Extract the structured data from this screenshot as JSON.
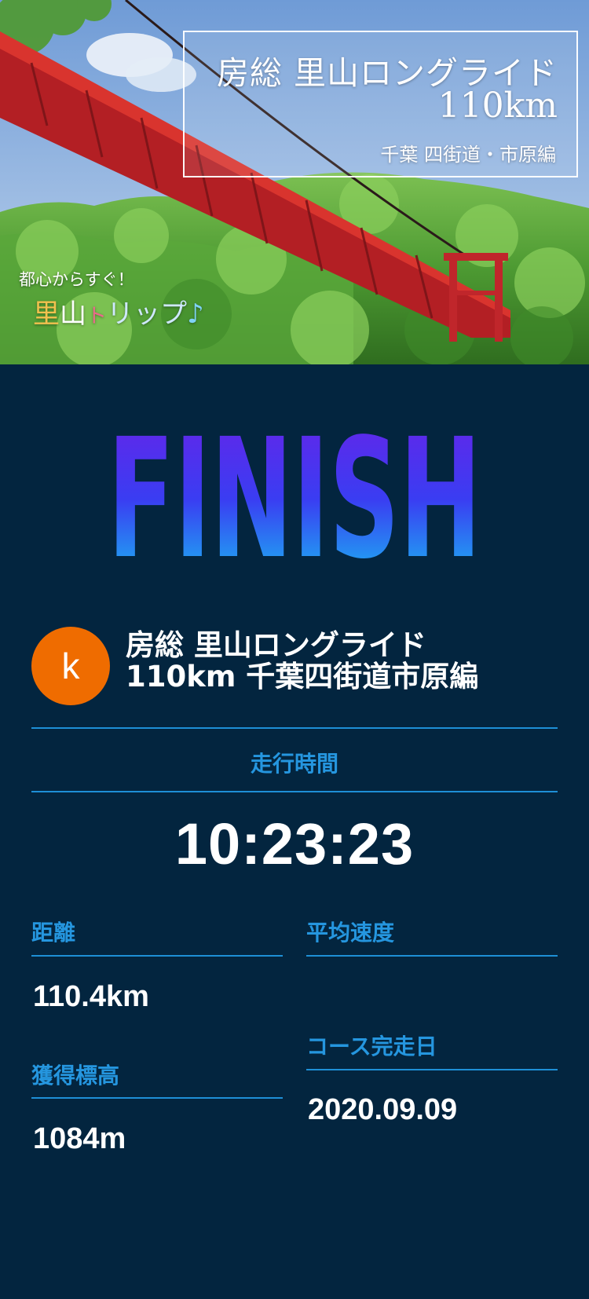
{
  "hero": {
    "title_line1": "房総 里山ロングライド",
    "title_line2": "110km",
    "title_line3": "千葉 四街道・市原編",
    "tagline_small": "都心からすぐ！",
    "tagline_big": [
      "里",
      "山",
      "ト",
      "リップ",
      "♪"
    ]
  },
  "finish": {
    "text": "FINISH",
    "gradient_top": "#6a22e8",
    "gradient_mid": "#3a3df2",
    "gradient_bottom": "#16c9f2"
  },
  "course": {
    "avatar_letter": "k",
    "avatar_color": "#ef6c00",
    "name_line1": "房総 里山ロングライド",
    "name_line2": "110km 千葉四街道市原編"
  },
  "stats": {
    "time_label": "走行時間",
    "time_value": "10:23:23",
    "distance_label": "距離",
    "distance_value": "110.4km",
    "avg_speed_label": "平均速度",
    "avg_speed_value": "",
    "elevation_label": "獲得標高",
    "elevation_value": "1084m",
    "date_label": "コース完走日",
    "date_value": "2020.09.09"
  },
  "colors": {
    "background": "#03253f",
    "accent": "#2596df"
  }
}
